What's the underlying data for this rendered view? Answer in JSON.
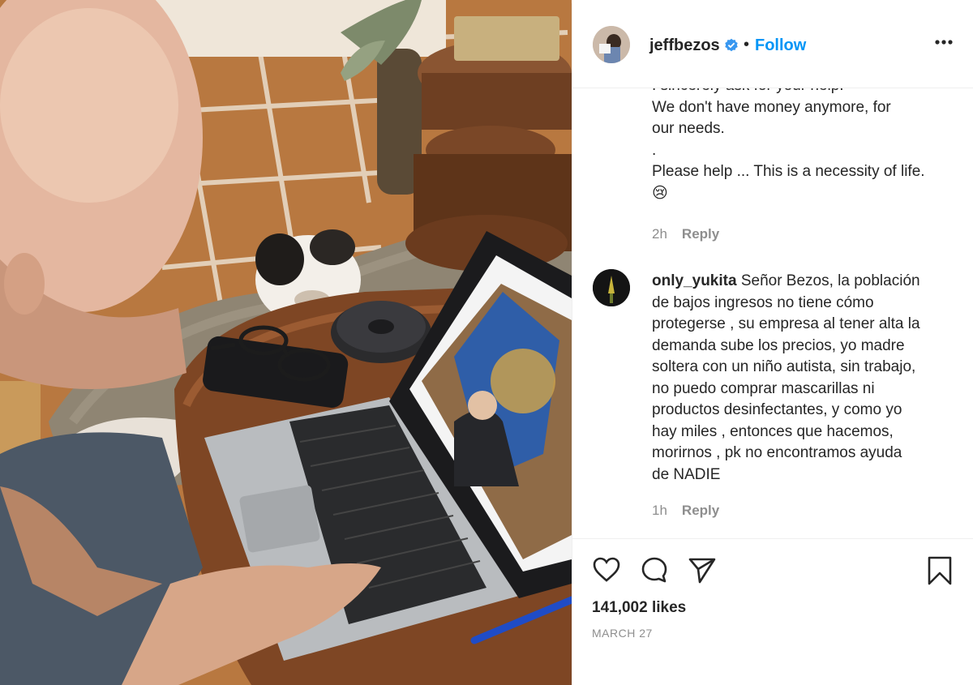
{
  "post": {
    "username": "jeffbezos",
    "dot": "•",
    "follow_label": "Follow"
  },
  "icons": {
    "verified": "verified-badge-icon",
    "more": "more-options-icon",
    "like": "heart-icon",
    "comment": "comment-bubble-icon",
    "share": "paper-plane-icon",
    "save": "bookmark-icon"
  },
  "comments": [
    {
      "lines": [
        "I sincerely ask for your help.",
        "We don't have money anymore, for",
        "our needs.",
        ".",
        "Please help ... This is a necessity of life."
      ],
      "emoji": "😢",
      "time": "2h",
      "reply_label": "Reply"
    },
    {
      "username": "only_yukita",
      "text_line1": " Señor Bezos, la población",
      "lines": [
        "de bajos ingresos no tiene cómo",
        "protegerse , su empresa al tener alta la",
        "demanda sube los precios, yo madre",
        "soltera con un niño autista, sin trabajo,",
        "no puedo comprar mascarillas ni",
        "productos desinfectantes, y como yo",
        "hay miles , entonces que hacemos,",
        "morirnos , pk no encontramos ayuda",
        "de NADIE"
      ],
      "time": "1h",
      "reply_label": "Reply"
    }
  ],
  "footer": {
    "likes": "141,002 likes",
    "date": "MARCH 27"
  },
  "colors": {
    "link_blue": "#0095f6",
    "verified_blue": "#3897f0",
    "muted": "#8e8e8e",
    "text": "#262626"
  }
}
